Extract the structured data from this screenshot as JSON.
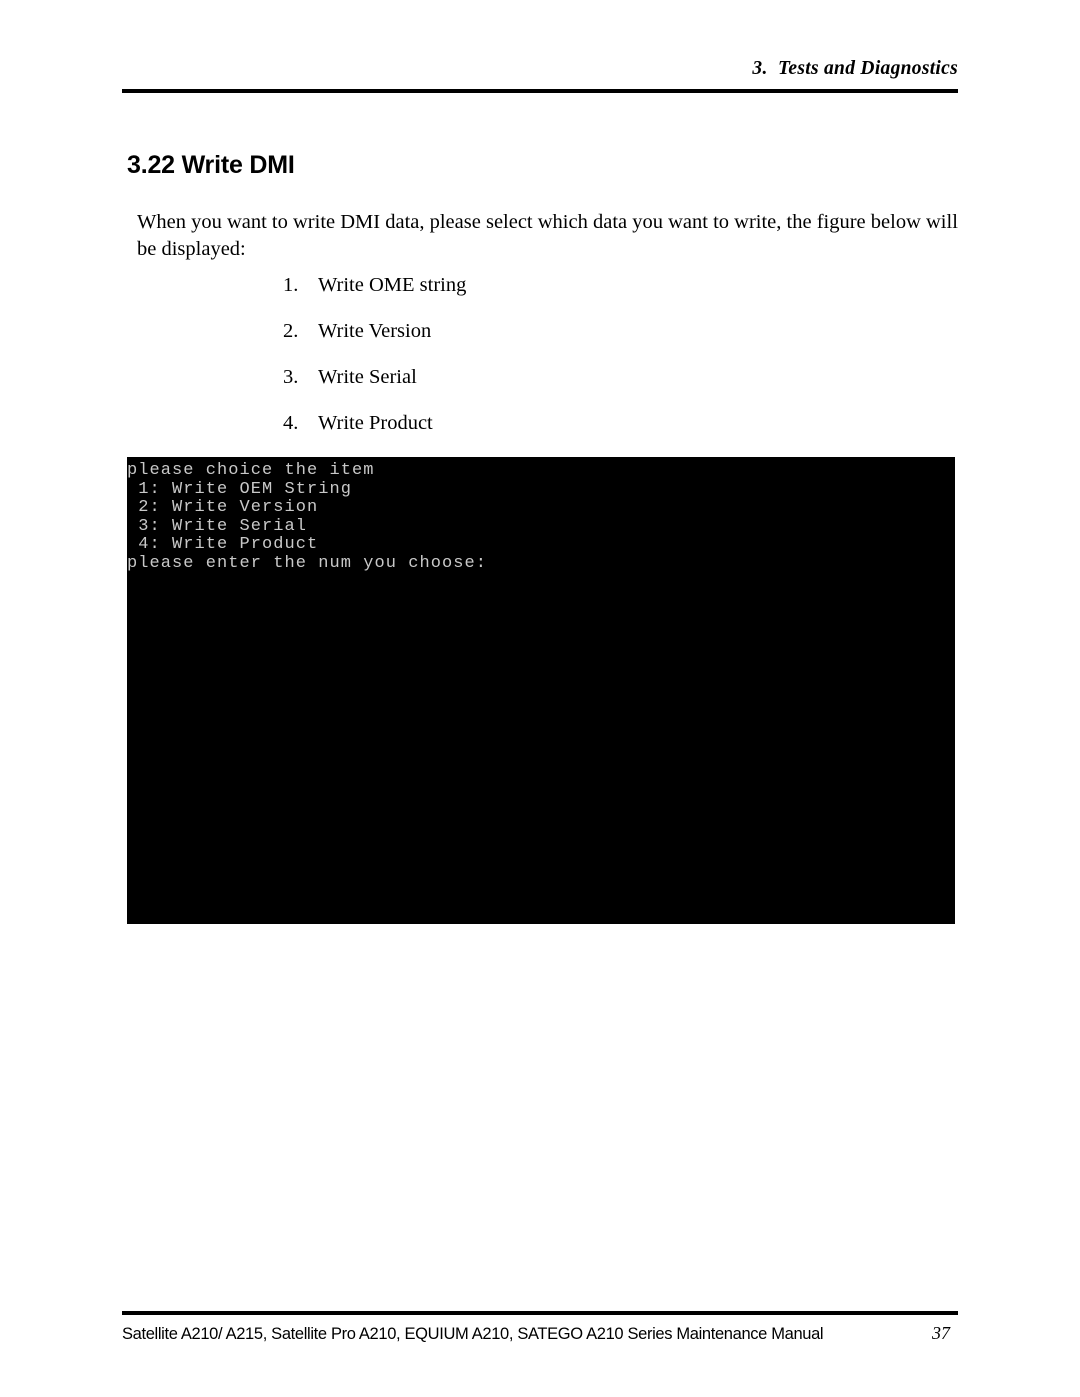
{
  "header": {
    "chapter_title": "3.  Tests and Diagnostics"
  },
  "section": {
    "heading": "3.22 Write DMI",
    "paragraph": "When you want to write DMI data, please select which data you want to write, the figure below will be displayed:",
    "options": [
      {
        "number": "1.",
        "label": "Write OME string"
      },
      {
        "number": "2.",
        "label": "Write Version"
      },
      {
        "number": "3.",
        "label": "Write Serial"
      },
      {
        "number": "4.",
        "label": "Write Product"
      }
    ]
  },
  "terminal": {
    "background_color": "#000000",
    "text_color": "#c8c8c8",
    "lines": [
      "please choice the item",
      " 1: Write OEM String",
      " 2: Write Version",
      " 3: Write Serial",
      " 4: Write Product",
      "please enter the num you choose:"
    ]
  },
  "footer": {
    "manual_title": "Satellite A210/ A215, Satellite Pro A210, EQUIUM A210, SATEGO A210 Series Maintenance Manual",
    "page_number": "37"
  }
}
